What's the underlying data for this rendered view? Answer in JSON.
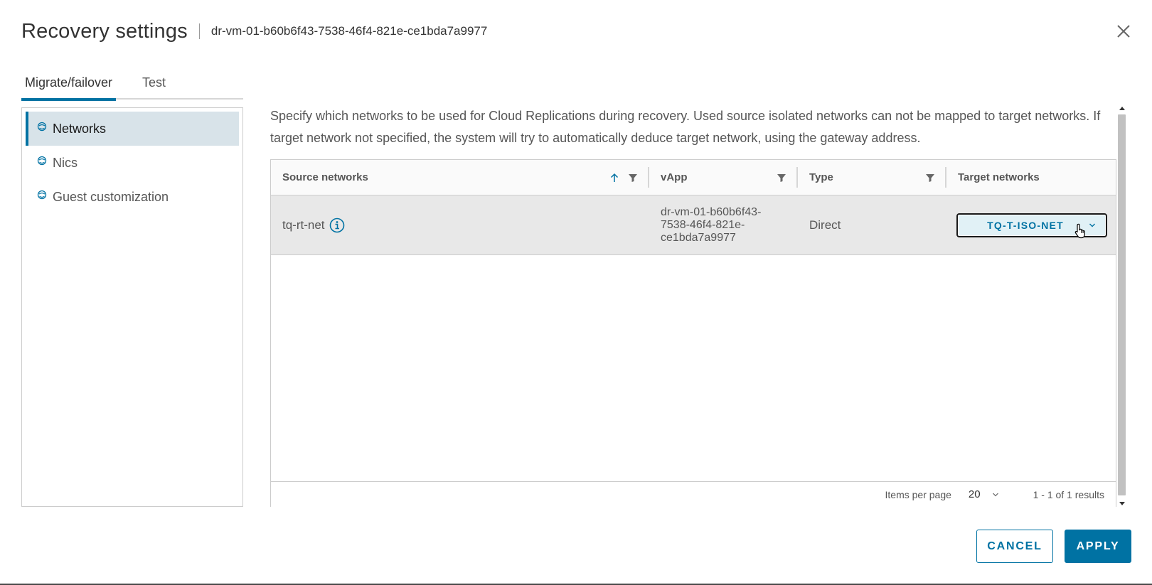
{
  "dialog": {
    "title": "Recovery settings",
    "subtitle": "dr-vm-01-b60b6f43-7538-46f4-821e-ce1bda7a9977"
  },
  "tabs": [
    {
      "label": "Migrate/failover",
      "active": true
    },
    {
      "label": "Test",
      "active": false
    }
  ],
  "nav": {
    "items": [
      {
        "label": "Networks",
        "icon": "network-icon",
        "active": true
      },
      {
        "label": "Nics",
        "icon": "network-icon",
        "active": false
      },
      {
        "label": "Guest customization",
        "icon": "network-icon",
        "active": false
      }
    ]
  },
  "main": {
    "description": "Specify which networks to be used for Cloud Replications during recovery. Used source isolated networks can not be mapped to target networks. If target network not specified, the system will try to automatically deduce target network, using the gateway address.",
    "grid": {
      "columns": {
        "source": "Source networks",
        "vapp": "vApp",
        "type": "Type",
        "target": "Target networks"
      },
      "rows": [
        {
          "source": "tq-rt-net",
          "vapp": "dr-vm-01-b60b6f43-\n7538-46f4-821e-\nce1bda7a9977",
          "type": "Direct",
          "target": "TQ-T-ISO-NET"
        }
      ],
      "footer": {
        "items_per_page_label": "Items per page",
        "items_per_page_value": "20",
        "results": "1 - 1 of 1 results"
      }
    }
  },
  "footer": {
    "cancel_label": "CANCEL",
    "apply_label": "APPLY"
  },
  "colors": {
    "accent": "#0072a3",
    "selected_nav_bg": "#d8e3e9",
    "row_bg": "#e8e8e8"
  }
}
